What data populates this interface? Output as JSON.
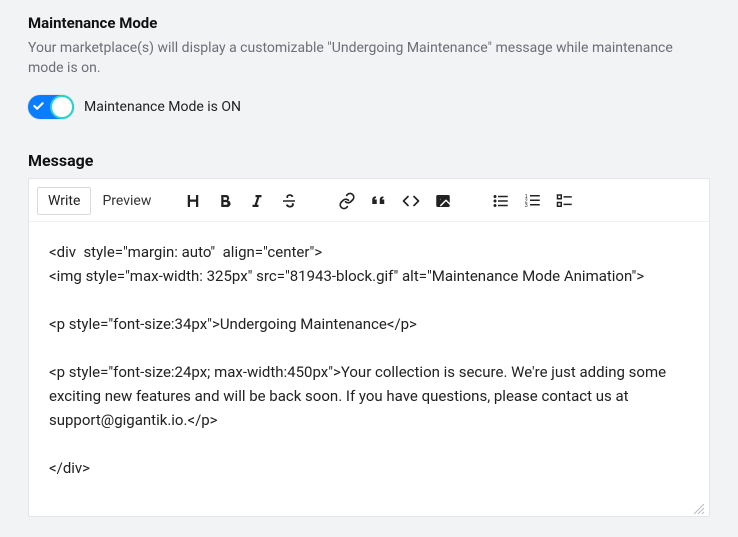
{
  "maintenance": {
    "title": "Maintenance Mode",
    "description": "Your marketplace(s) will display a customizable \"Undergoing Maintenance\" message while maintenance mode is on.",
    "toggle_on": true,
    "toggle_label": "Maintenance Mode is ON"
  },
  "message": {
    "title": "Message",
    "tabs": {
      "write": "Write",
      "preview": "Preview"
    },
    "content": "<div  style=\"margin: auto\"  align=\"center\">\n<img style=\"max-width: 325px\" src=\"81943-block.gif\" alt=\"Maintenance Mode Animation\">\n\n<p style=\"font-size:34px\">Undergoing Maintenance</p>\n\n<p style=\"font-size:24px; max-width:450px\">Your collection is secure. We're just adding some exciting new features and will be back soon. If you have questions, please contact us at support@gigantik.io.</p>\n\n</div>"
  },
  "toolbar_icons": {
    "heading": "heading-icon",
    "bold": "bold-icon",
    "italic": "italic-icon",
    "strike": "strikethrough-icon",
    "link": "link-icon",
    "quote": "quote-icon",
    "code": "code-icon",
    "image": "image-icon",
    "ulist": "unordered-list-icon",
    "olist": "ordered-list-icon",
    "tasklist": "task-list-icon"
  }
}
